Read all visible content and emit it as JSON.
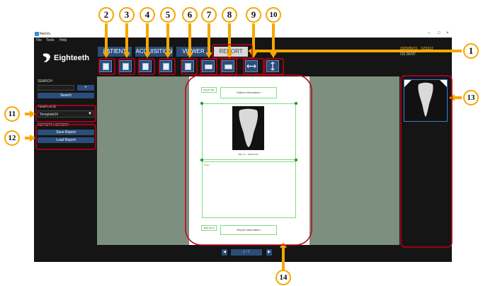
{
  "window": {
    "title": "NeoVu",
    "controls": [
      "–",
      "□",
      "×"
    ]
  },
  "menu": [
    "File",
    "Tools",
    "Help"
  ],
  "brand": "Eighteeth",
  "header_info": {
    "line1": "2020/09/11 · VZ3312",
    "line2": "OS DENT"
  },
  "tabs": [
    {
      "label": "PATIENT",
      "active": false
    },
    {
      "label": "ACQUISITION",
      "active": false
    },
    {
      "label": "VIEWER",
      "active": false
    },
    {
      "label": "REPORT",
      "active": true
    }
  ],
  "toolbar": [
    "new-report",
    "page-layout-1",
    "page-layout-2",
    "copy-page",
    "page-layout-3",
    "print",
    "print-preview",
    "fit-width",
    "fit-height"
  ],
  "left_panel": {
    "search_label": "SEARCH",
    "search_value": "",
    "search_add": "+",
    "search_button": "Search",
    "template_label": "TEMPLATE",
    "template_value": "Template04",
    "template_arrow": "▼",
    "history_label": "REPORT HISTORY",
    "save_button": "Save Report",
    "load_button": "Load Report"
  },
  "report_page": {
    "header_tag": "Report Title",
    "header_box": "Patient Information",
    "image_caption": "IMG_01 · 2020-09-11",
    "notes_label": "Notes",
    "footer_tag": "2020-09-11",
    "footer_box": "Report Information"
  },
  "pager": {
    "prev": "◀",
    "page": "1 / 1",
    "next": "▶"
  },
  "callouts": [
    "1",
    "2",
    "3",
    "4",
    "5",
    "6",
    "7",
    "8",
    "9",
    "10",
    "11",
    "12",
    "13",
    "14"
  ],
  "colors": {
    "accent_orange": "#f5a800",
    "highlight_red": "#c4001a",
    "tab_blue": "#2a4d7a",
    "viewer_bg": "#7d8f7e"
  }
}
